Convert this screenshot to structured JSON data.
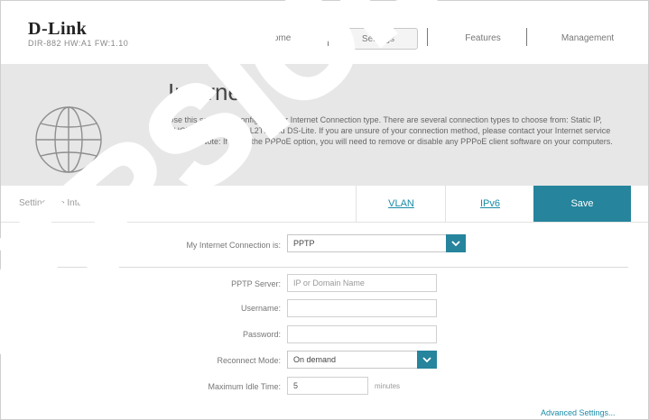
{
  "brand": {
    "logo": "D-Link",
    "model": "DIR-882 HW:A1 FW:1.10"
  },
  "nav": {
    "home": "Home",
    "settings": "Settings",
    "features": "Features",
    "management": "Management"
  },
  "page": {
    "title": "Internet",
    "description": "Use this section to configure your Internet Connection type. There are several connection types to choose from: Static IP, DHCP, PPPoE, PPTP, L2TP and DS-Lite. If you are unsure of your connection method, please contact your Internet service provider. Note: If using the PPPoE option, you will need to remove or disable any PPPoE client software on your computers."
  },
  "breadcrumb": "Settings >> Internet >> IPv4",
  "tabs": {
    "vlan": "VLAN",
    "ipv6": "IPv6",
    "save": "Save"
  },
  "form": {
    "connection_label": "My Internet Connection is:",
    "connection_value": "PPTP",
    "server_label": "PPTP Server:",
    "server_placeholder": "IP or Domain Name",
    "username_label": "Username:",
    "password_label": "Password:",
    "reconnect_label": "Reconnect Mode:",
    "reconnect_value": "On demand",
    "idle_label": "Maximum Idle Time:",
    "idle_value": "5",
    "idle_unit": "minutes"
  },
  "advanced_link": "Advanced Settings...",
  "watermark": "VERSION",
  "colors": {
    "accent": "#26849d",
    "link": "#1a8ca8",
    "banner": "#e7e7e7"
  }
}
